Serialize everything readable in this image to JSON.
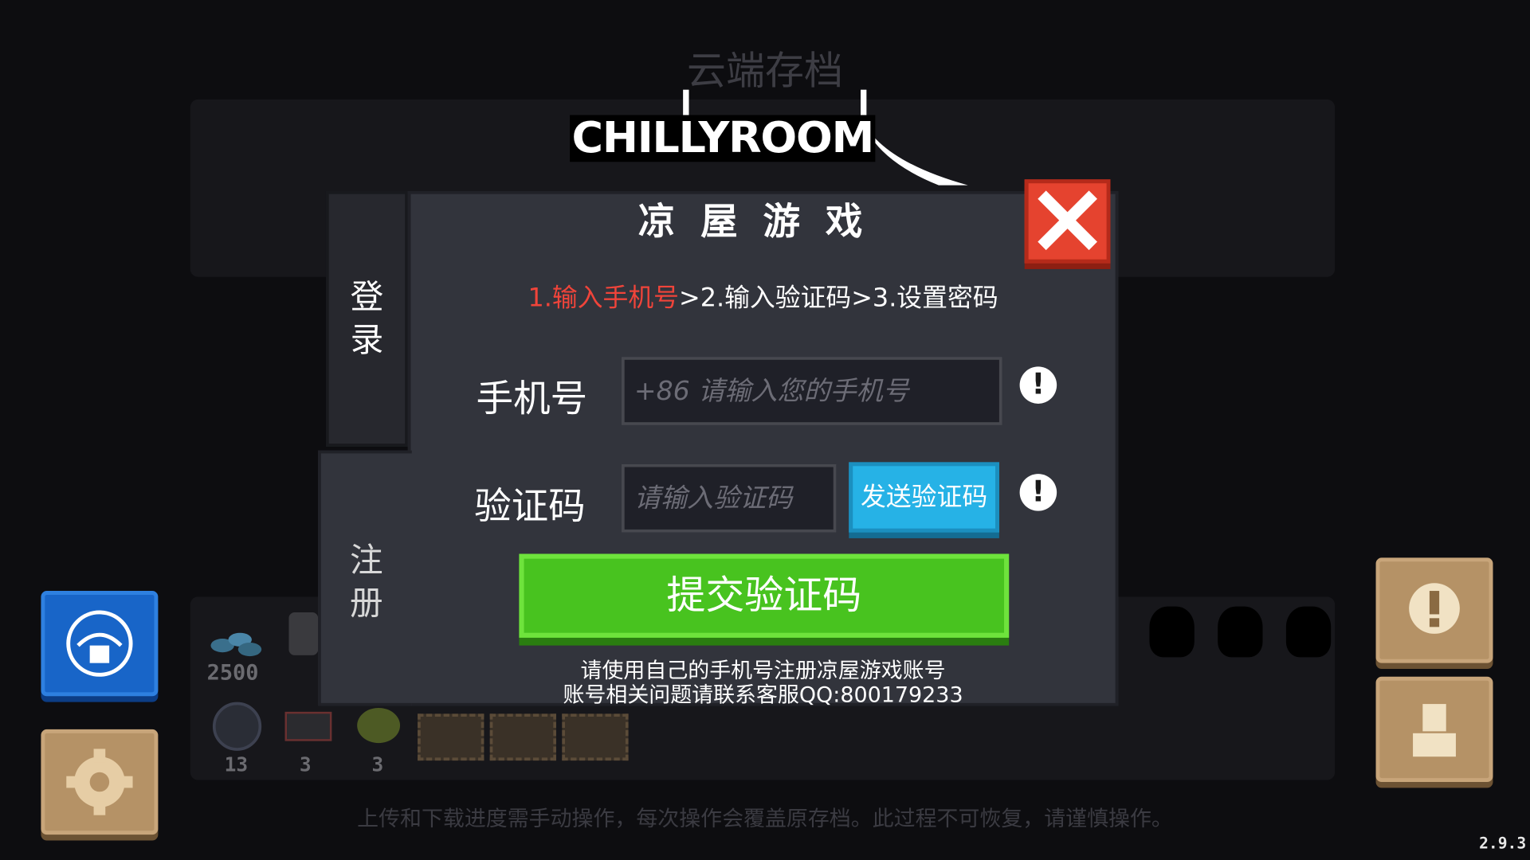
{
  "background": {
    "title": "云端存档",
    "footer": "上传和下载进度需手动操作，每次操作会覆盖原存档。此过程不可恢复，请谨慎操作。",
    "currency": "2500",
    "counts": [
      "13",
      "3",
      "3"
    ]
  },
  "version": "2.9.3",
  "logo": {
    "text": "CHILLYROOM",
    "company": "凉屋游戏"
  },
  "tabs": {
    "login": "登录",
    "register": "注册"
  },
  "steps": {
    "step1": "1.输入手机号",
    "rest": ">2.输入验证码>3.设置密码"
  },
  "form": {
    "phone_label": "手机号",
    "phone_placeholder": "+86 请输入您的手机号",
    "code_label": "验证码",
    "code_placeholder": "请输入验证码",
    "send_code": "发送验证码",
    "submit": "提交验证码"
  },
  "notes": {
    "line1": "请使用自己的手机号注册凉屋游戏账号",
    "line2": "账号相关问题请联系客服QQ:800179233"
  },
  "colors": {
    "step_active": "#f0443a",
    "send_button": "#26b2e6",
    "submit_button": "#48c31f",
    "close_button": "#e5432f"
  }
}
